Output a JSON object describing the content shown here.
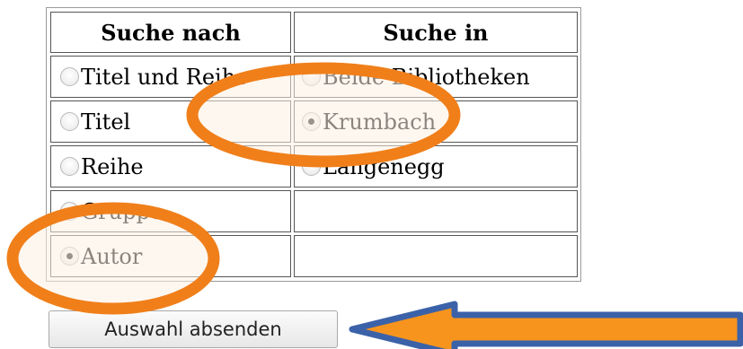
{
  "table": {
    "headers": [
      "Suche nach",
      "Suche in"
    ],
    "search_by": [
      {
        "label": "Titel und Reihe",
        "checked": false
      },
      {
        "label": "Titel",
        "checked": false
      },
      {
        "label": "Reihe",
        "checked": false
      },
      {
        "label": "Gruppe",
        "checked": false
      },
      {
        "label": "Autor",
        "checked": true
      }
    ],
    "search_in": [
      {
        "label": "Beide Bibliotheken",
        "checked": false
      },
      {
        "label": "Krumbach",
        "checked": true
      },
      {
        "label": "Langenegg",
        "checked": false
      }
    ]
  },
  "submit": {
    "label": "Auswahl absenden"
  },
  "colors": {
    "highlight_ellipse": "#f07f1a",
    "highlight_fill": "#fdf0e4",
    "arrow_body": "#f7941e",
    "arrow_outline": "#3b62a8"
  },
  "annotations": {
    "ellipse_icon": "orange-ellipse-highlight",
    "arrow_icon": "orange-left-arrow"
  }
}
